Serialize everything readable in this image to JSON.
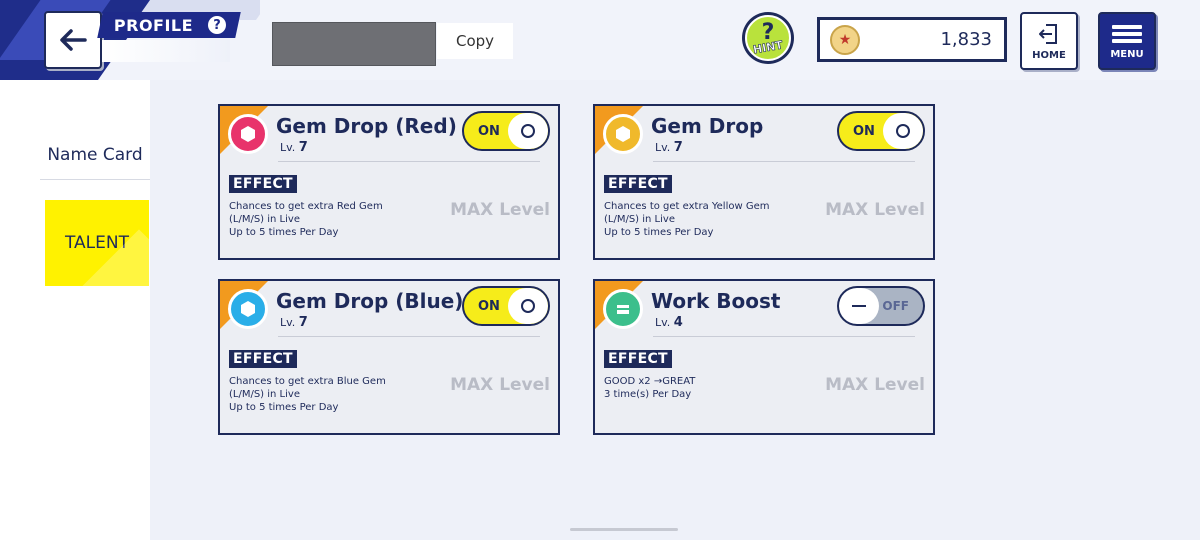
{
  "header": {
    "profile_label": "PROFILE",
    "help_glyph": "?",
    "copy_label": "Copy",
    "hint_glyph": "?",
    "hint_label": "HINT",
    "coins": "1,833",
    "home_label": "HOME",
    "menu_label": "MENU"
  },
  "sidebar": {
    "items": [
      {
        "label": "Name Card",
        "selected": false
      },
      {
        "label": "TALENT",
        "selected": true
      }
    ]
  },
  "cards": [
    {
      "title": "Gem Drop (Red)",
      "lv_prefix": "Lv.",
      "level": "7",
      "effect_label": "EFFECT",
      "desc1": "Chances to get extra Red Gem",
      "desc2": "(L/M/S) in Live",
      "desc3": "Up to 5 times Per Day",
      "max_label": "MAX Level",
      "toggle_label": "ON",
      "gem_color": "#e8336b",
      "toggle": "on"
    },
    {
      "title": "Gem Drop",
      "lv_prefix": "Lv.",
      "level": "7",
      "effect_label": "EFFECT",
      "desc1": "Chances to get extra Yellow Gem",
      "desc2": "(L/M/S) in Live",
      "desc3": "Up to 5 times Per Day",
      "max_label": "MAX Level",
      "toggle_label": "ON",
      "gem_color": "#f0b92b",
      "toggle": "on"
    },
    {
      "title": "Gem Drop (Blue)",
      "lv_prefix": "Lv.",
      "level": "7",
      "effect_label": "EFFECT",
      "desc1": "Chances to get extra Blue Gem",
      "desc2": "(L/M/S) in Live",
      "desc3": "Up to 5 times Per Day",
      "max_label": "MAX Level",
      "toggle_label": "ON",
      "gem_color": "#2aaee8",
      "toggle": "on"
    },
    {
      "title": "Work Boost",
      "lv_prefix": "Lv.",
      "level": "4",
      "effect_label": "EFFECT",
      "desc1": "GOOD x2 →GREAT",
      "desc2": "3 time(s) Per Day",
      "desc3": "",
      "max_label": "MAX Level",
      "toggle_label": "OFF",
      "gem_color": "#3cbf8c",
      "toggle": "off"
    }
  ],
  "colors": {
    "navy": "#1e2a5a",
    "accent_yellow": "#fff200",
    "ribbon_orange": "#f29a1e"
  }
}
